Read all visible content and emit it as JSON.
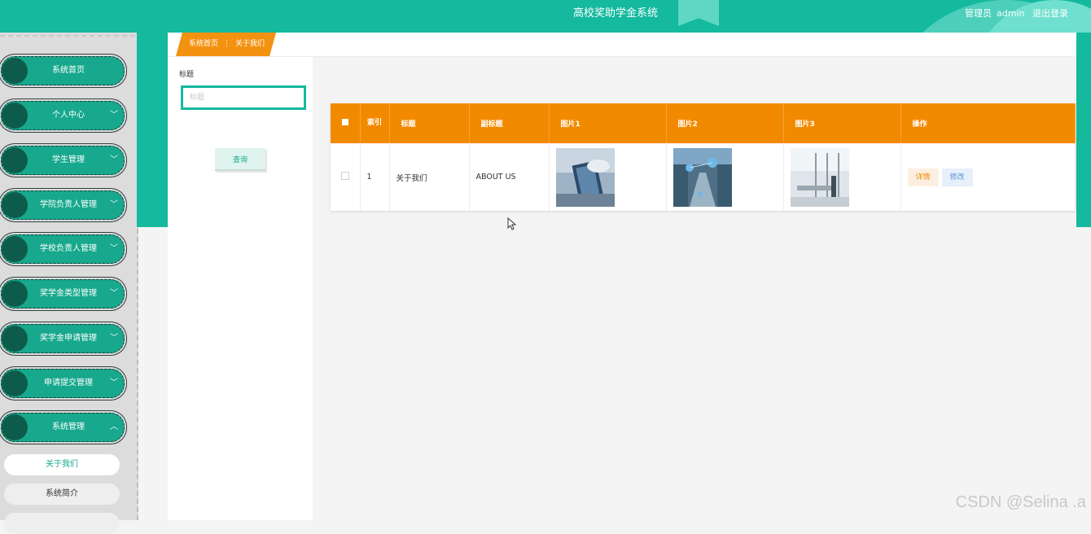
{
  "header": {
    "app_title": "高校奖助学金系统",
    "user_role": "管理员",
    "user_name": "admin",
    "logout": "退出登录"
  },
  "sidebar": {
    "items": [
      {
        "label": "系统首页"
      },
      {
        "label": "个人中心"
      },
      {
        "label": "学生管理"
      },
      {
        "label": "学院负责人管理"
      },
      {
        "label": "学校负责人管理"
      },
      {
        "label": "奖学金类型管理"
      },
      {
        "label": "奖学金申请管理"
      },
      {
        "label": "申请提交管理"
      },
      {
        "label": "系统管理"
      }
    ],
    "sub_items": [
      {
        "label": "关于我们",
        "active": true
      },
      {
        "label": "系统简介",
        "active": false
      }
    ]
  },
  "breadcrumb": {
    "home": "系统首页",
    "current": "关于我们"
  },
  "search": {
    "label": "标题",
    "placeholder": "标题",
    "button": "查询"
  },
  "table": {
    "headers": {
      "index": "索引",
      "title": "标题",
      "subtitle": "副标题",
      "image1": "图片1",
      "image2": "图片2",
      "image3": "图片3",
      "actions": "操作"
    },
    "rows": [
      {
        "index": "1",
        "title": "关于我们",
        "subtitle": "ABOUT US",
        "detail": "详情",
        "edit": "修改"
      }
    ]
  },
  "watermark": "CSDN @Selina .a",
  "colors": {
    "primary": "#14b99e",
    "accent": "#f28a00",
    "nav_item": "#17a88d"
  }
}
